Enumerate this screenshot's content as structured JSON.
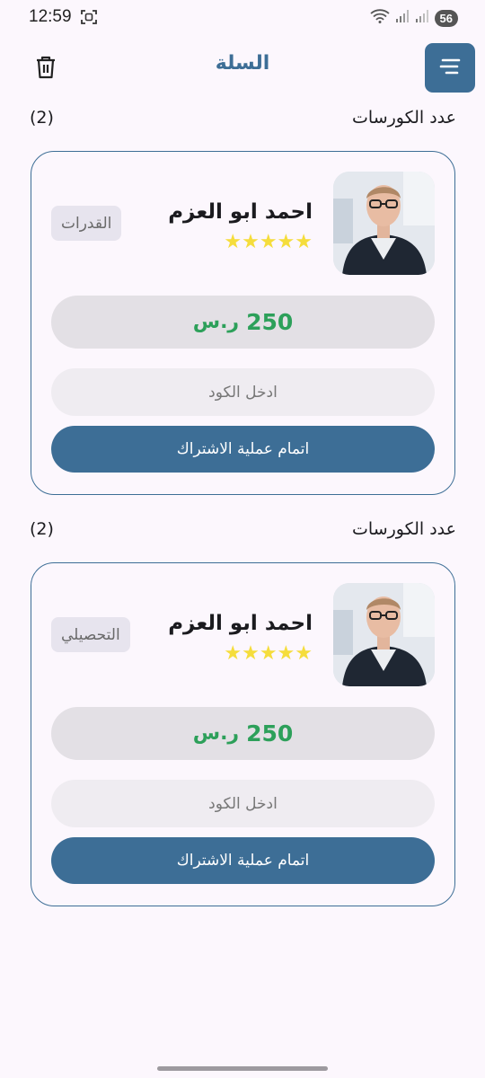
{
  "status_bar": {
    "time": "12:59",
    "battery": "56",
    "icons": [
      "screenshot-icon",
      "wifi-icon",
      "signal-icon",
      "signal-icon"
    ]
  },
  "header": {
    "title": "السلة",
    "trash_icon": "trash-icon",
    "menu_icon": "menu-icon"
  },
  "colors": {
    "primary": "#3d6e96",
    "price": "#2da05a",
    "star": "#f5dd3c",
    "background": "#fcf7fd"
  },
  "courses": [
    {
      "count_label": "عدد الكورسات",
      "count_value": "(2)",
      "instructor_name": "احمد ابو العزم",
      "rating": "★★★★★",
      "rating_value": 5,
      "category": "القدرات",
      "price": "250",
      "currency": "ر.س",
      "code_placeholder": "ادخل الكود",
      "subscribe_label": "اتمام عملية الاشتراك"
    },
    {
      "count_label": "عدد الكورسات",
      "count_value": "(2)",
      "instructor_name": "احمد ابو العزم",
      "rating": "★★★★★",
      "rating_value": 5,
      "category": "التحصيلي",
      "price": "250",
      "currency": "ر.س",
      "code_placeholder": "ادخل الكود",
      "subscribe_label": "اتمام عملية الاشتراك"
    }
  ]
}
